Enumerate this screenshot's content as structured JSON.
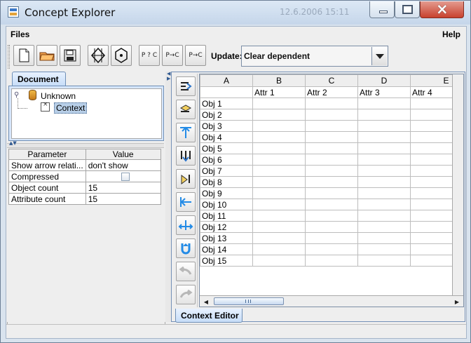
{
  "window": {
    "title": "Concept Explorer",
    "ghost_text": "12.6.2006 15:11",
    "controls": [
      "minimize",
      "maximize",
      "close"
    ]
  },
  "menu": {
    "files_label": "Files",
    "help_label": "Help"
  },
  "toolbar": {
    "buttons": [
      {
        "icon": "new-document-icon"
      },
      {
        "icon": "open-folder-icon"
      },
      {
        "icon": "save-icon"
      },
      {
        "icon": "lattice-diagram-icon"
      },
      {
        "icon": "hexagon-diagram-icon"
      },
      {
        "icon": "query-implication-icon",
        "text": "P ? C"
      },
      {
        "icon": "implication-icon",
        "text": "P→C"
      },
      {
        "icon": "association-rule-icon",
        "text": "P→C"
      }
    ],
    "update_label": "Update:",
    "update_value": "Clear dependent"
  },
  "document_panel": {
    "tab_label": "Document",
    "tree": {
      "root": "Unknown",
      "child": "Context"
    }
  },
  "parameters": {
    "headers": [
      "Parameter",
      "Value"
    ],
    "rows": [
      {
        "name": "Show arrow relati...",
        "value": "don't show"
      },
      {
        "name": "Compressed",
        "value": ""
      },
      {
        "name": "Object count",
        "value": "15"
      },
      {
        "name": "Attribute count",
        "value": "15"
      }
    ]
  },
  "context_editor": {
    "tab_label": "Context Editor",
    "column_letters": [
      "A",
      "B",
      "C",
      "D",
      "E"
    ],
    "attributes": [
      "",
      "Attr 1",
      "Attr 2",
      "Attr 3",
      "Attr 4"
    ],
    "objects": [
      "Obj 1",
      "Obj 2",
      "Obj 3",
      "Obj 4",
      "Obj 5",
      "Obj 6",
      "Obj 7",
      "Obj 8",
      "Obj 9",
      "Obj 10",
      "Obj 11",
      "Obj 12",
      "Obj 13",
      "Obj 14",
      "Obj 15"
    ],
    "side_tools": [
      "add-object-icon",
      "edit-object-icon",
      "move-up-icon",
      "add-attribute-icon",
      "edit-attribute-icon",
      "move-left-icon",
      "split-icon",
      "undo-arrow-icon",
      "back-icon",
      "forward-icon"
    ]
  },
  "colors": {
    "selection": "#b8cfe8",
    "tab_blue": "#c7ddf8",
    "accent": "#315a91"
  }
}
